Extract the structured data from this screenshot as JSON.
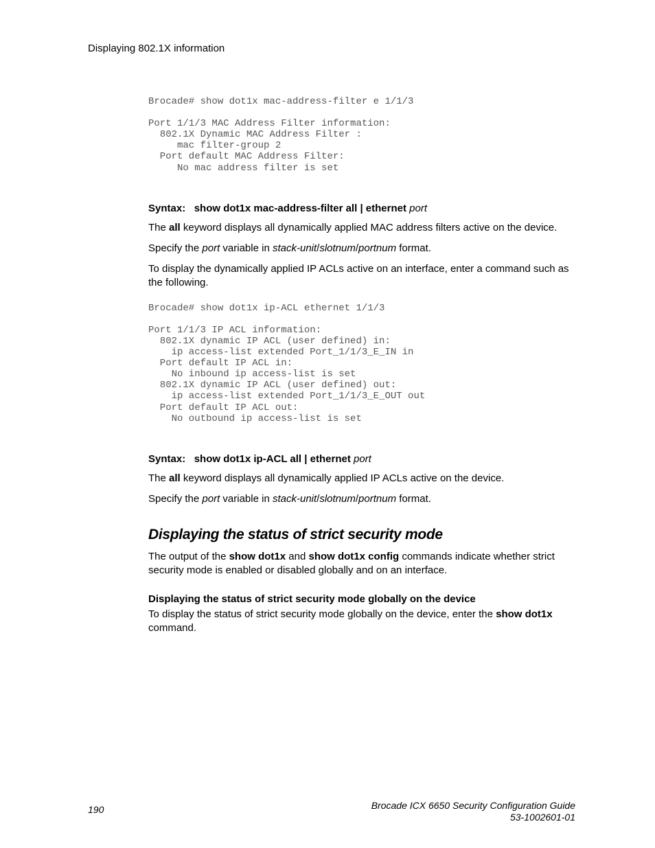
{
  "header": {
    "title": "Displaying 802.1X information"
  },
  "code1": "Brocade# show dot1x mac-address-filter e 1/1/3\n\nPort 1/1/3 MAC Address Filter information:\n  802.1X Dynamic MAC Address Filter :\n     mac filter-group 2\n  Port default MAC Address Filter:\n     No mac address filter is set",
  "syntax1": {
    "label": "Syntax:",
    "cmd": "show dot1x mac-address-filter all | ethernet",
    "arg": "port"
  },
  "para1a_pre": "The ",
  "para1a_b": "all",
  "para1a_post": " keyword displays all dynamically applied MAC address filters active on the device.",
  "para1b_pre": "Specify the ",
  "para1b_i1": "port",
  "para1b_mid1": " variable in ",
  "para1b_i2": "stack-unit",
  "para1b_sep1": "/",
  "para1b_i3": "slotnum",
  "para1b_sep2": "/",
  "para1b_i4": "portnum",
  "para1b_post": " format.",
  "para1c": "To display the dynamically applied IP ACLs active on an interface, enter a command such as the following.",
  "code2": "Brocade# show dot1x ip-ACL ethernet 1/1/3\n\nPort 1/1/3 IP ACL information:\n  802.1X dynamic IP ACL (user defined) in:\n    ip access-list extended Port_1/1/3_E_IN in\n  Port default IP ACL in:\n    No inbound ip access-list is set\n  802.1X dynamic IP ACL (user defined) out:\n    ip access-list extended Port_1/1/3_E_OUT out\n  Port default IP ACL out:\n    No outbound ip access-list is set",
  "syntax2": {
    "label": "Syntax:",
    "cmd": "show dot1x ip-ACL all | ethernet",
    "arg": "port"
  },
  "para2a_pre": "The ",
  "para2a_b": "all",
  "para2a_post": " keyword displays all dynamically applied IP ACLs active on the device.",
  "para2b_pre": "Specify the ",
  "para2b_i1": "port",
  "para2b_mid1": " variable in ",
  "para2b_i2": "stack-unit",
  "para2b_sep1": "/",
  "para2b_i3": "slotnum",
  "para2b_sep2": "/",
  "para2b_i4": "portnum",
  "para2b_post": " format.",
  "h2": "Displaying the status of strict security mode",
  "para3_pre": "The output of the ",
  "para3_b1": "show dot1x",
  "para3_mid": " and ",
  "para3_b2": "show dot1x config",
  "para3_post": " commands indicate whether strict security mode is enabled or disabled globally and on an interface.",
  "sub_b": "Displaying the status of strict security mode globally on the device",
  "para4_pre": "To display the status of strict security mode globally on the device, enter the ",
  "para4_b": "show dot1x",
  "para4_post": " command.",
  "footer": {
    "pagenum": "190",
    "doc_title": "Brocade ICX 6650 Security Configuration Guide",
    "doc_num": "53-1002601-01"
  }
}
